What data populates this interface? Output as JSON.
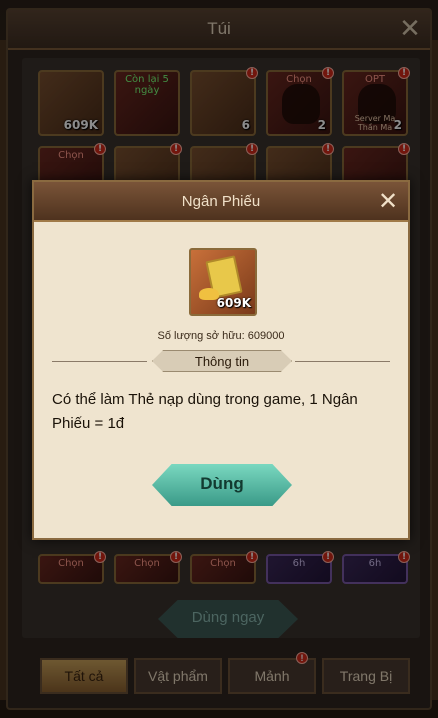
{
  "bag": {
    "title": "Túi",
    "close": "✕",
    "slots": [
      {
        "count": "609K",
        "tag": ""
      },
      {
        "count": "",
        "tag": "Còn lại 5 ngày"
      },
      {
        "count": "6",
        "tag": ""
      },
      {
        "count": "2",
        "tag": "Chọn"
      },
      {
        "count": "2",
        "tag": "OPT",
        "tag2": "Server Ma Thần Ma"
      },
      {
        "count": "",
        "tag": "Chọn"
      }
    ],
    "bottom_slots": [
      {
        "tag": "Chọn"
      },
      {
        "tag": "Chọn"
      },
      {
        "tag": "Chọn"
      },
      {
        "tag": "6h"
      },
      {
        "tag": "6h"
      }
    ],
    "use_now": "Dùng ngay",
    "tabs": [
      "Tất cả",
      "Vật phẩm",
      "Mảnh",
      "Trang Bị"
    ],
    "badge": "!"
  },
  "modal": {
    "title": "Ngân Phiếu",
    "close": "✕",
    "item_count": "609K",
    "owned": "Số lượng sở hữu: 609000",
    "info_label": "Thông tin",
    "description": "Có thể làm Thẻ nạp dùng trong game, 1 Ngân Phiếu = 1đ",
    "use_label": "Dùng"
  }
}
